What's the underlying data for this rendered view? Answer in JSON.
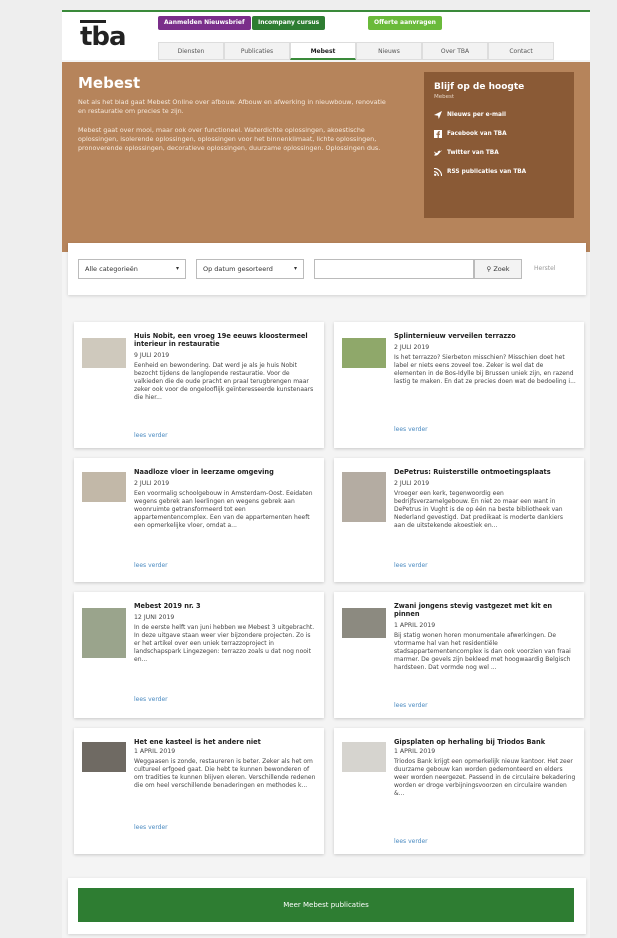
{
  "header": {
    "logo": "tba",
    "pills": [
      "Aanmelden Nieuwsbrief",
      "Incompany cursus",
      "Offerte aanvragen"
    ],
    "nav": [
      "Diensten",
      "Publicaties",
      "Mebest",
      "Nieuws",
      "Over TBA",
      "Contact"
    ],
    "active_nav": "Mebest"
  },
  "hero": {
    "title": "Mebest",
    "desc1": "Net als het blad gaat Mebest Online over afbouw. Afbouw en afwerking in nieuwbouw, renovatie en restauratie om precies te zijn.",
    "desc2": "Mebest gaat over mooi, maar ook over functioneel. Waterdichte oplossingen, akoestische oplossingen, isolerende oplossingen, oplossingen voor het binnenklimaat, lichte oplossingen, pronoverende oplossingen, decoratieve oplossingen, duurzame oplossingen. Oplossingen dus.",
    "side_title": "Blijf op de hoogte",
    "side_sub": "Mebest",
    "side_links": [
      "Nieuws per e-mail",
      "Facebook van TBA",
      "Twitter van TBA",
      "RSS publicaties van TBA"
    ]
  },
  "filter": {
    "category": "Alle categorieën",
    "sort": "Op datum gesorteerd",
    "search_placeholder": "",
    "search_button": "Zoek",
    "reset": "Herstel"
  },
  "cards": [
    {
      "title": "Huis Nobit, een vroeg 19e eeuws kloostermeel interieur in restauratie",
      "date": "9 JULI 2019",
      "text": "Eenheid en bewondering. Dat werd je als je huis Nobit bezocht tijdens de langlopende restauratie. Voor de valkieden die de oude pracht en praal terugbrengen maar zeker ook voor de ongelooflijk geïnteresseerde kunstenaars die hier...",
      "more": "lees verder"
    },
    {
      "title": "Splinternieuw verveilen terrazzo",
      "date": "2 JULI 2019",
      "text": "Is het terrazzo? Sierbeton misschien? Misschien doet het label er niets eens zoveel toe. Zeker is wel dat de elementen in de Bos-Idylle bij Brussen uniek zijn, en razend lastig te maken. En dat ze precies doen wat de bedoeling i...",
      "more": "lees verder"
    },
    {
      "title": "Naadloze vloer in leerzame omgeving",
      "date": "2 JULI 2019",
      "text": "Een voormalig schoolgebouw in Amsterdam-Oost. Eeidaten wegens gebrek aan leerlingen en wegens gebrek aan woonruimte getransformeerd tot een appartementencomplex. Een van de appartementen heeft een opmerkelijke vloer, omdat a...",
      "more": "lees verder"
    },
    {
      "title": "DePetrus: Ruisterstille ontmoetingsplaats",
      "date": "2 JULI 2019",
      "text": "Vroeger een kerk, tegenwoordig een bedrijfsverzamelgebouw. En niet zo maar een want in DePetrus in Vught is de op één na beste bibliotheek van Nederland gevestigd. Dat predikaat is moderte dankiers aan de uitstekende akoestiek en...",
      "more": "lees verder"
    },
    {
      "title": "Mebest 2019 nr. 3",
      "date": "12 JUNI 2019",
      "text": "In de eerste helft van juni hebben we Mebest 3 uitgebracht. In deze uitgave staan weer vier bijzondere projecten. Zo is er het artikel over een uniek terrazzoproject in landschapspark Lingezegen: terrazzo zoals u dat nog nooit en...",
      "more": "lees verder"
    },
    {
      "title": "Zwani jongens stevig vastgezet met kit en pinnen",
      "date": "1 APRIL 2019",
      "text": "Bij statig wonen horen monumentale afwerkingen. De vtormame hal van het residentiële stadsappartementencomplex is dan ook voorzien van fraai marmer. De gevels zijn bekleed met hoogwaardig Belgisch hardsteen. Dat vormde nog wel ...",
      "more": "lees verder"
    },
    {
      "title": "Het ene kasteel is het andere niet",
      "date": "1 APRIL 2019",
      "text": "Weggaasen is zonde, restaureren is beter. Zeker als het om cultureel erfgoed gaat. Die hebt te kunnen bewonderen of om tradities te kunnen blijven eleren. Verschillende redenen die om heel verschillende benaderingen en methodes k...",
      "more": "lees verder"
    },
    {
      "title": "Gipsplaten op herhaling bij Triodos Bank",
      "date": "1 APRIL 2019",
      "text": "Triodos Bank krijgt een opmerkelijk nieuw kantoor. Het zeer duurzame gebouw kan worden gedemonteerd en elders weer worden neergezet. Passend in de circulaire bekadering worden er droge verbijningsvoorzen en circulaire wanden &...",
      "more": "lees verder"
    }
  ],
  "more_button": "Meer Mebest publicaties",
  "colors": {
    "green": "#2e7d32",
    "hero": "#b6845b",
    "purple": "#7a2e8a",
    "lightgreen": "#6aba3a"
  }
}
